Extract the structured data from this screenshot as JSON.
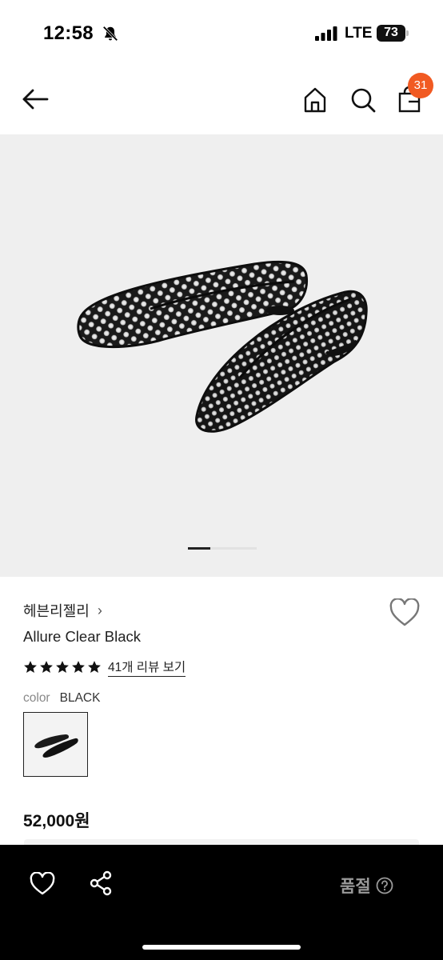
{
  "status_bar": {
    "time": "12:58",
    "network": "LTE",
    "battery": "73"
  },
  "top_nav": {
    "back_icon": "arrow-left-icon",
    "home_icon": "home-icon",
    "search_icon": "search-icon",
    "cart_icon": "shopping-bag-icon",
    "cart_count": "31",
    "badge_color": "#f15a22"
  },
  "gallery": {
    "current_slide": 1
  },
  "product": {
    "brand": "헤븐리젤리",
    "brand_chevron": "›",
    "name": "Allure Clear Black",
    "rating_stars": 5,
    "review_link": "41개 리뷰 보기",
    "color_label": "color",
    "color_value": "BLACK",
    "price": "52,000원"
  },
  "bottom_bar": {
    "wish_icon": "heart-icon",
    "share_icon": "share-icon",
    "status_label": "품절",
    "help_icon": "question-circle-icon"
  }
}
